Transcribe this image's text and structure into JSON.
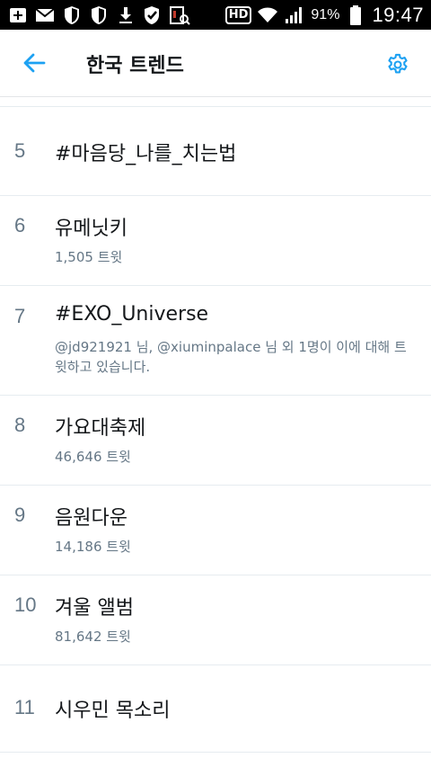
{
  "status_bar": {
    "hd_label": "HD",
    "battery": "91%",
    "time": "19:47"
  },
  "header": {
    "title": "한국 트렌드"
  },
  "colors": {
    "accent": "#1da1f2",
    "text_primary": "#14171a",
    "text_secondary": "#657786",
    "divider": "#e6ecf0"
  },
  "trends": [
    {
      "rank": "5",
      "name": "#마음당_나를_치는법",
      "meta": ""
    },
    {
      "rank": "6",
      "name": "유메닛키",
      "meta": "1,505 트윗"
    },
    {
      "rank": "7",
      "name": "#EXO_Universe",
      "meta": "@jd921921 님, @xiuminpalace 님 외 1명이 이에 대해 트윗하고 있습니다."
    },
    {
      "rank": "8",
      "name": "가요대축제",
      "meta": "46,646 트윗"
    },
    {
      "rank": "9",
      "name": "음원다운",
      "meta": "14,186 트윗"
    },
    {
      "rank": "10",
      "name": "겨울 앨범",
      "meta": "81,642 트윗"
    },
    {
      "rank": "11",
      "name": "시우민 목소리",
      "meta": ""
    }
  ]
}
